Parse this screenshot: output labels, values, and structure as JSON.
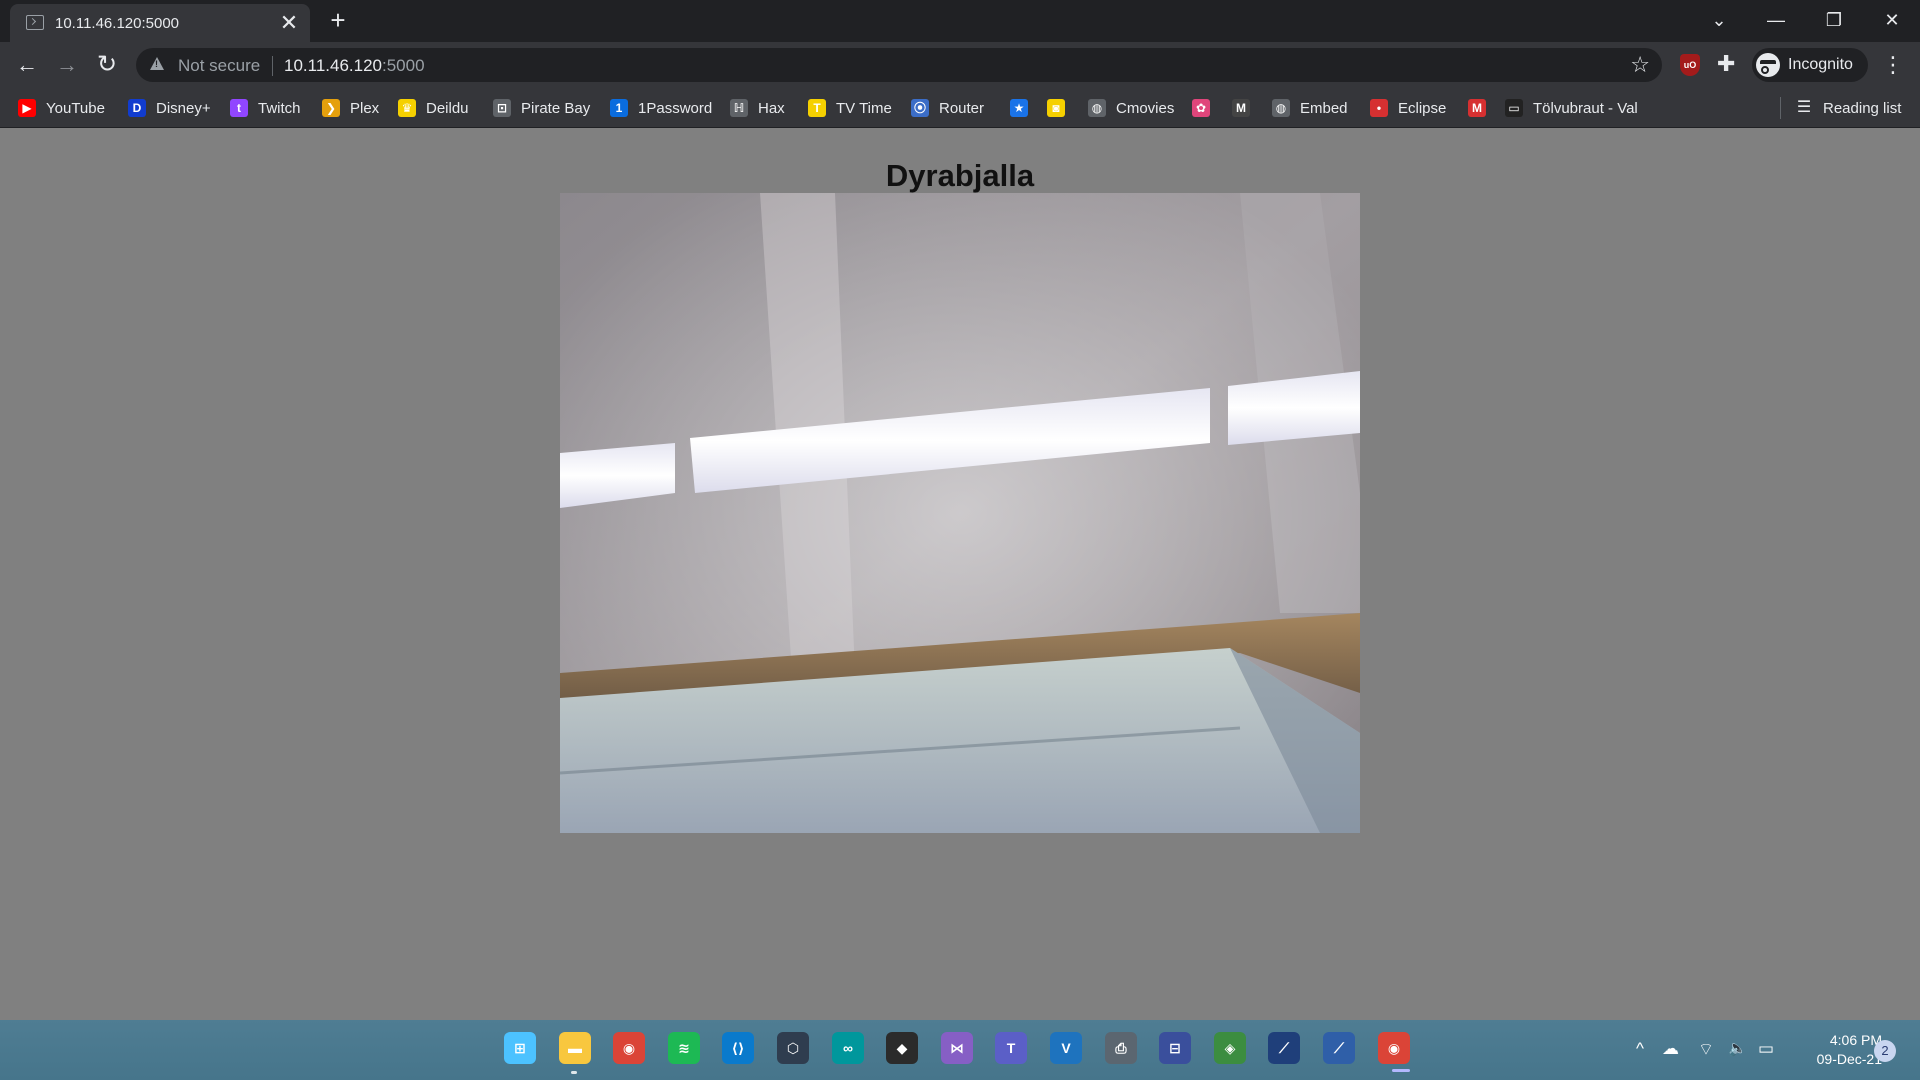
{
  "tab": {
    "title": "10.11.46.120:5000",
    "close_glyph": "✕",
    "new_tab_glyph": "+"
  },
  "window_controls": {
    "search_tabs": "⌄",
    "minimize": "—",
    "maximize": "❐",
    "close": "✕"
  },
  "toolbar": {
    "back_glyph": "←",
    "forward_glyph": "→",
    "reload_glyph": "↻",
    "security_label": "Not secure",
    "url_host": "10.11.46.120",
    "url_port": ":5000",
    "star_glyph": "☆",
    "ublock_text": "uO",
    "extensions_glyph": "✚",
    "incognito_label": "Incognito",
    "menu_glyph": "⋮"
  },
  "bookmarks": [
    {
      "label": "YouTube",
      "icon": "youtube-icon",
      "color": "#ff0000",
      "glyph": "▶"
    },
    {
      "label": "Disney+",
      "icon": "disney-icon",
      "color": "#113ccf",
      "glyph": "D"
    },
    {
      "label": "Twitch",
      "icon": "twitch-icon",
      "color": "#9146ff",
      "glyph": "t"
    },
    {
      "label": "Plex",
      "icon": "plex-icon",
      "color": "#e5a00d",
      "glyph": "❯"
    },
    {
      "label": "Deildu",
      "icon": "crown-icon",
      "color": "#f5d000",
      "glyph": "♛"
    },
    {
      "label": "Pirate Bay",
      "icon": "pirate-bay-icon",
      "color": "#5f6368",
      "glyph": "⊡"
    },
    {
      "label": "1Password",
      "icon": "onepassword-icon",
      "color": "#0a6cde",
      "glyph": "1"
    },
    {
      "label": "Hax",
      "icon": "hax-icon",
      "color": "#5f6368",
      "glyph": "ℍ"
    },
    {
      "label": "TV Time",
      "icon": "tvtime-icon",
      "color": "#f5d000",
      "glyph": "T"
    },
    {
      "label": "Router",
      "icon": "router-icon",
      "color": "#3b6dc7",
      "glyph": "⦿"
    },
    {
      "label": "",
      "icon": "star-bookmark-icon",
      "color": "#1a73e8",
      "glyph": "★"
    },
    {
      "label": "",
      "icon": "mask-icon",
      "color": "#f5d000",
      "glyph": "◙"
    },
    {
      "label": "Cmovies",
      "icon": "globe-icon",
      "color": "#5f6368",
      "glyph": "◍"
    },
    {
      "label": "",
      "icon": "flower-icon",
      "color": "#e0457b",
      "glyph": "✿"
    },
    {
      "label": "",
      "icon": "mm-icon",
      "color": "#444444",
      "glyph": "M"
    },
    {
      "label": "Embed",
      "icon": "globe-icon",
      "color": "#5f6368",
      "glyph": "◍"
    },
    {
      "label": "Eclipse",
      "icon": "eclipse-icon",
      "color": "#d63031",
      "glyph": "•"
    },
    {
      "label": "",
      "icon": "m-red-icon",
      "color": "#d63031",
      "glyph": "M"
    },
    {
      "label": "Tölvubraut - Val",
      "icon": "laptop-icon",
      "color": "#222222",
      "glyph": "▭"
    }
  ],
  "reading_list": {
    "label": "Reading list",
    "glyph": "☰"
  },
  "page": {
    "title": "Dyrabjalla"
  },
  "taskbar": {
    "apps": [
      {
        "name": "windows-start-icon",
        "color": "#4cc2ff",
        "glyph": "⊞"
      },
      {
        "name": "file-explorer-icon",
        "color": "#f8c73e",
        "glyph": "▬"
      },
      {
        "name": "chrome-icon",
        "color": "#db4437",
        "glyph": "◉"
      },
      {
        "name": "spotify-icon",
        "color": "#1db954",
        "glyph": "≋"
      },
      {
        "name": "vscode-icon",
        "color": "#0a7acc",
        "glyph": "⟨⟩"
      },
      {
        "name": "virtualbox-icon",
        "color": "#2f3d4f",
        "glyph": "⬡"
      },
      {
        "name": "arduino-icon",
        "color": "#00979c",
        "glyph": "∞"
      },
      {
        "name": "inkscape-icon",
        "color": "#2b2b2b",
        "glyph": "◆"
      },
      {
        "name": "visual-studio-icon",
        "color": "#865fc5",
        "glyph": "⋈"
      },
      {
        "name": "teams-icon",
        "color": "#5b5fc7",
        "glyph": "T"
      },
      {
        "name": "vs-code-alt-icon",
        "color": "#1e73be",
        "glyph": "V"
      },
      {
        "name": "printer-icon",
        "color": "#5b6670",
        "glyph": "⎙"
      },
      {
        "name": "network-icon",
        "color": "#3a4f9c",
        "glyph": "⊟"
      },
      {
        "name": "map-tool-icon",
        "color": "#3c8d40",
        "glyph": "◈"
      },
      {
        "name": "app-blue-1-icon",
        "color": "#1f3f7a",
        "glyph": "⟋"
      },
      {
        "name": "app-blue-2-icon",
        "color": "#2f5fa8",
        "glyph": "⟋"
      },
      {
        "name": "chrome-active-icon",
        "color": "#db4437",
        "glyph": "◉"
      }
    ],
    "tray": {
      "chevron": "^",
      "onedrive": "☁",
      "wifi": "⌔",
      "volume": "🔈",
      "battery": "▭"
    },
    "time": "4:06 PM",
    "date": "09-Dec-21",
    "notifications": "2"
  }
}
